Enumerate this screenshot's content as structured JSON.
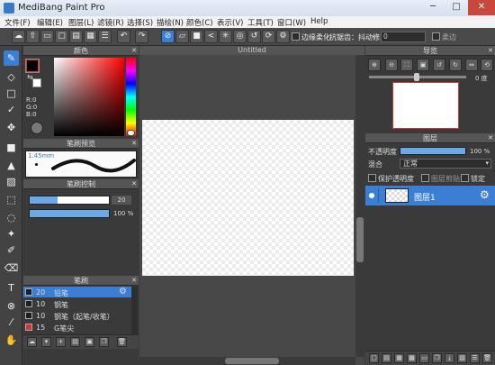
{
  "window": {
    "title": "MediBang Paint Pro",
    "min": "─",
    "max": "□",
    "close": "✕"
  },
  "menu": [
    "文件(F)",
    "编辑(E)",
    "图层(L)",
    "滤镜(R)",
    "选择(S)",
    "描绘(N)",
    "颜色(C)",
    "表示(V)",
    "工具(T)",
    "窗口(W)",
    "Help"
  ],
  "toolbar": {
    "antialias_label": "边缘柔化",
    "stabilizer_label": "抗锯齿：抖动修正",
    "stabilizer_value": "0",
    "softedge_label": "柔边"
  },
  "color_panel": {
    "title": "颜色",
    "r_label": "R:0",
    "g_label": "G:0",
    "b_label": "B:0",
    "primary_color": "#000000",
    "secondary_color": "#ffffff"
  },
  "brush_preview": {
    "title": "笔刷预览",
    "size_label": "1.45mm"
  },
  "brush_control": {
    "title": "笔刷控制",
    "size_value": "20",
    "opacity_value": "100 %"
  },
  "brush_panel": {
    "title": "笔刷",
    "items": [
      {
        "size": "20",
        "name": "铅笔",
        "color": "#1e1e1e"
      },
      {
        "size": "10",
        "name": "钢笔",
        "color": "#1e1e1e"
      },
      {
        "size": "10",
        "name": "钢笔（起笔/收笔）",
        "color": "#1e1e1e"
      },
      {
        "size": "15",
        "name": "G笔尖",
        "color": "#d83232"
      }
    ]
  },
  "canvas": {
    "tab": "Untitled"
  },
  "navigator": {
    "title": "导览",
    "angle": "0 度"
  },
  "layers": {
    "title": "图层",
    "opacity_label": "不透明度",
    "opacity_value": "100 %",
    "blend_label": "混合",
    "blend_value": "正常",
    "protect_label": "保护透明度",
    "clip_label": "图层剪贴",
    "lock_label": "锁定",
    "items": [
      {
        "name": "图层1"
      }
    ]
  },
  "accent": "#3b7fd4"
}
